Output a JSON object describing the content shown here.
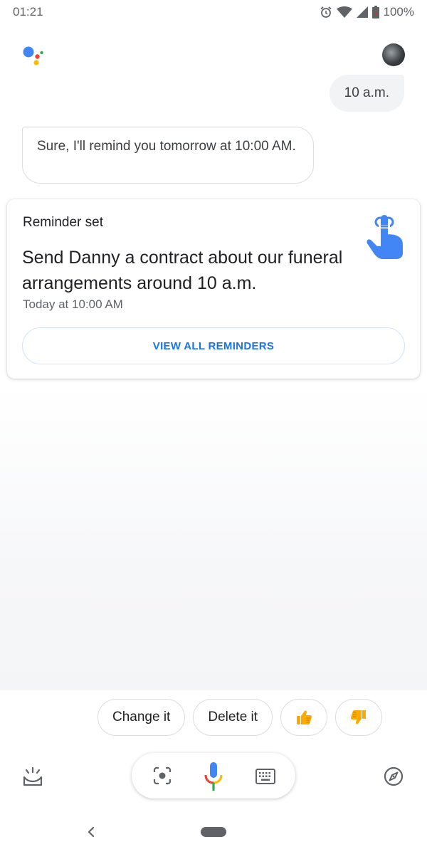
{
  "status_bar": {
    "time": "01:21",
    "battery": "100%",
    "icons": [
      "alarm-icon",
      "wifi-icon",
      "signal-icon",
      "battery-icon"
    ]
  },
  "conversation": {
    "user_message": "10 a.m.",
    "assistant_message": "Sure, I'll remind you tomorrow at 10:00 AM."
  },
  "reminder_card": {
    "heading": "Reminder set",
    "title": "Send Danny a contract about our funeral arrangements around 10 a.m.",
    "time": "Today at 10:00 AM",
    "button_label": "VIEW ALL REMINDERS",
    "icon": "finger-string-reminder-icon"
  },
  "suggestion_chips": [
    {
      "label": "Change it"
    },
    {
      "label": "Delete it"
    },
    {
      "icon": "thumbs-up-icon"
    },
    {
      "icon": "thumbs-down-icon"
    }
  ],
  "bottom_bar": {
    "icons": [
      "snapshot-icon",
      "lens-icon",
      "mic-icon",
      "keyboard-icon",
      "explore-icon"
    ]
  },
  "colors": {
    "accent_blue": "#1a73e8",
    "google_blue": "#4285f4",
    "google_red": "#ea4335",
    "google_yellow": "#fbbc04",
    "google_green": "#34a853",
    "chip_emoji_yellow": "#f9ab00"
  }
}
